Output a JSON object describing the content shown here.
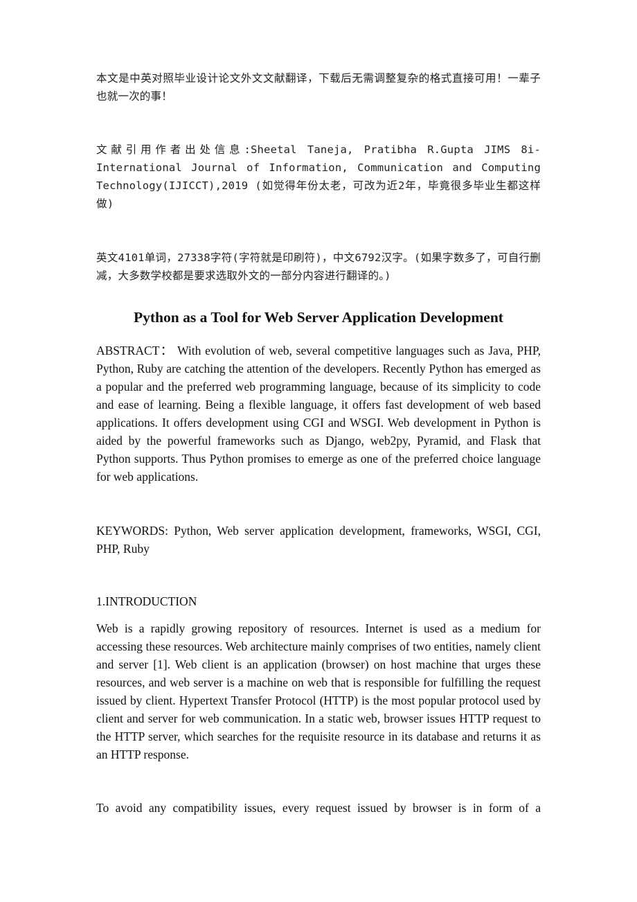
{
  "document": {
    "cn_note": "本文是中英对照毕业设计论文外文文献翻译，下载后无需调整复杂的格式直接可用！一辈子也就一次的事！",
    "citation": "文献引用作者出处信息:Sheetal Taneja, Pratibha R.Gupta    JIMS 8i-International Journal of Information, Communication and Computing Technology(IJICCT),2019 (如觉得年份太老，可改为近2年，毕竟很多毕业生都这样做)",
    "word_count_note": "英文4101单词，27338字符(字符就是印刷符)，中文6792汉字。(如果字数多了，可自行删减，大多数学校都是要求选取外文的一部分内容进行翻译的。)",
    "title": "Python as a Tool for Web Server Application Development",
    "abstract": "ABSTRACT： With evolution of web, several competitive languages such as Java, PHP, Python, Ruby are catching the attention of the developers. Recently Python has emerged as a popular and the preferred web programming language, because of its simplicity to code and ease of learning. Being a flexible language, it offers fast development of web based applications. It offers development using CGI and WSGI. Web development in Python is aided by the powerful frameworks such as Django, web2py, Pyramid, and Flask that Python supports. Thus Python promises to emerge as one of the preferred choice language for web applications.",
    "keywords": "KEYWORDS: Python, Web server application development, frameworks, WSGI, CGI, PHP, Ruby",
    "intro_heading": "1.INTRODUCTION",
    "intro_paragraph_1": "Web is a rapidly growing repository of resources. Internet is used as a medium for accessing these resources. Web architecture mainly comprises of two entities, namely client and server [1]. Web client is an application (browser) on host machine that urges these resources, and web server is a machine on web that is responsible for fulfilling the request issued by client. Hypertext Transfer Protocol (HTTP) is the most popular protocol used by client and server for web communication. In a static web, browser issues HTTP request to the HTTP server, which searches for the requisite resource in its database and returns it as an HTTP response.",
    "intro_paragraph_2": "To avoid any compatibility issues, every request issued by browser is in form of a"
  }
}
